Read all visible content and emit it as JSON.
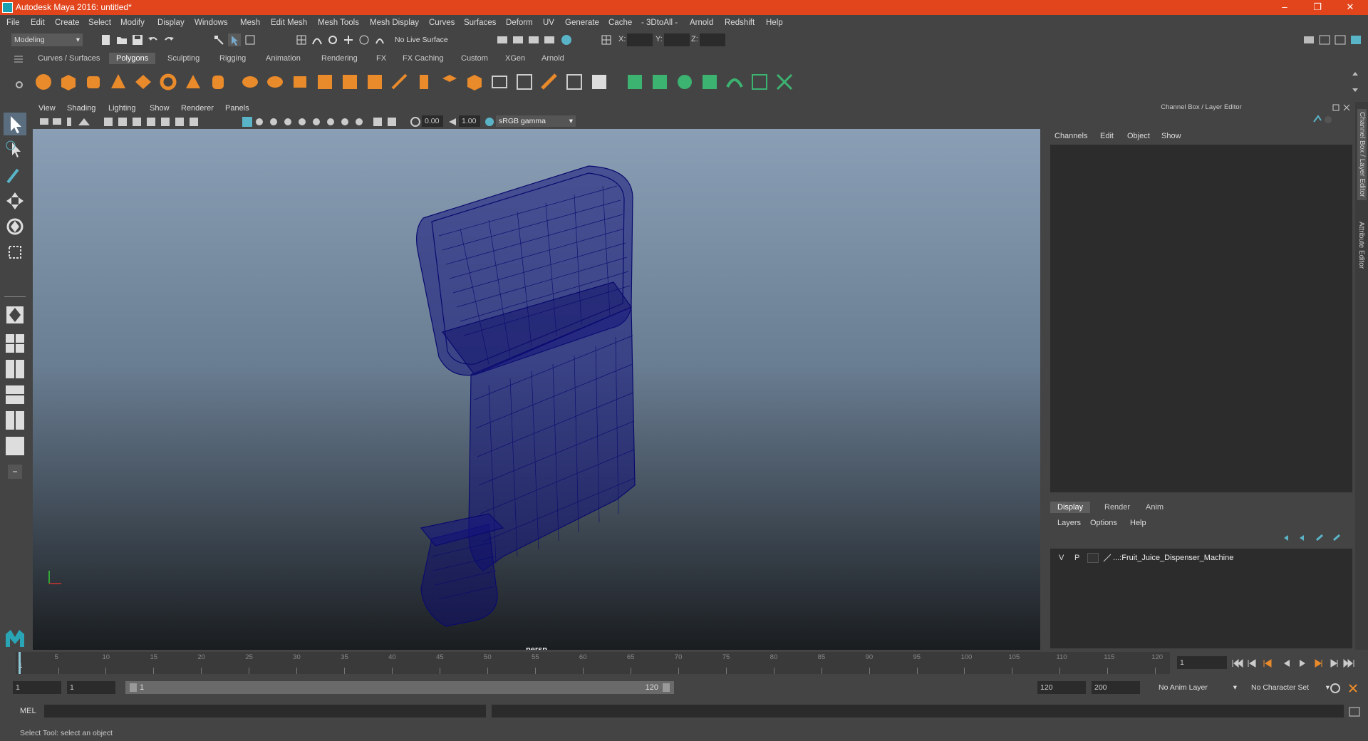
{
  "window": {
    "title": "Autodesk Maya 2016: untitled*"
  },
  "menubar": [
    "File",
    "Edit",
    "Create",
    "Select",
    "Modify",
    "Display",
    "Windows",
    "Mesh",
    "Edit Mesh",
    "Mesh Tools",
    "Mesh Display",
    "Curves",
    "Surfaces",
    "Deform",
    "UV",
    "Generate",
    "Cache",
    "- 3DtoAll -",
    "Arnold",
    "Redshift",
    "Help"
  ],
  "statusline": {
    "mode": "Modeling",
    "live_surface": "No Live Surface",
    "x_label": "X:",
    "y_label": "Y:",
    "z_label": "Z:"
  },
  "shelf_tabs": [
    "Curves / Surfaces",
    "Polygons",
    "Sculpting",
    "Rigging",
    "Animation",
    "Rendering",
    "FX",
    "FX Caching",
    "Custom",
    "XGen",
    "Arnold"
  ],
  "shelf_active": "Polygons",
  "viewport": {
    "menu": [
      "View",
      "Shading",
      "Lighting",
      "Show",
      "Renderer",
      "Panels"
    ],
    "exposure": "0.00",
    "gamma": "1.00",
    "colorspace": "sRGB gamma",
    "camera_label": "persp"
  },
  "channelbox": {
    "header": "Channel Box / Layer Editor",
    "menu": [
      "Channels",
      "Edit",
      "Object",
      "Show"
    ]
  },
  "layer_editor": {
    "tabs": [
      "Display",
      "Render",
      "Anim"
    ],
    "active_tab": "Display",
    "menu": [
      "Layers",
      "Options",
      "Help"
    ],
    "layers": [
      {
        "v": "V",
        "p": "P",
        "name": "...:Fruit_Juice_Dispenser_Machine"
      }
    ]
  },
  "side_tabs": [
    "Channel Box / Layer Editor",
    "Attribute Editor"
  ],
  "timeline": {
    "ticks": [
      5,
      10,
      15,
      20,
      25,
      30,
      35,
      40,
      45,
      50,
      55,
      60,
      65,
      70,
      75,
      80,
      85,
      90,
      95,
      100,
      105,
      110,
      115,
      120
    ],
    "start_label": "1",
    "current_frame": "1"
  },
  "range": {
    "start": "1",
    "playback_start": "1",
    "slider_start": "1",
    "slider_end": "120",
    "playback_end": "120",
    "end": "200",
    "anim_layer": "No Anim Layer",
    "char_set": "No Character Set"
  },
  "cmdline": {
    "label": "MEL"
  },
  "helpline": {
    "text": "Select Tool: select an object"
  },
  "colors": {
    "titlebar": "#e2451c",
    "wireframe": "#0a0a6e",
    "accent": "#5ab4c8"
  }
}
